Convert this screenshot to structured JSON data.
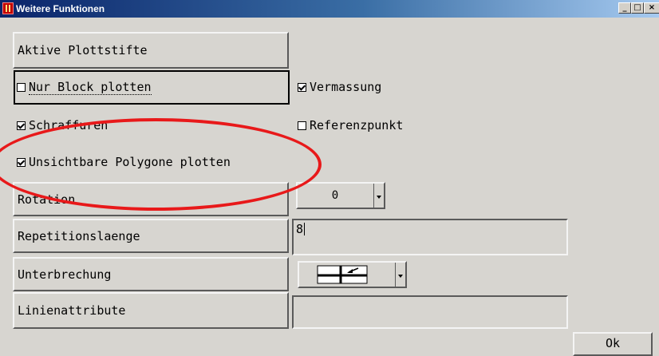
{
  "window": {
    "title": "Weitere Funktionen",
    "min": "_",
    "max": "□",
    "close": "×"
  },
  "buttons": {
    "aktive_plottstifte": "Aktive Plottstifte",
    "rotation": "Rotation",
    "repetitionslaenge": "Repetitionslaenge",
    "unterbrechung": "Unterbrechung",
    "linienattribute": "Linienattribute",
    "ok": "Ok"
  },
  "checkboxes": {
    "nur_block_plotten": {
      "label": "Nur Block plotten",
      "checked": false
    },
    "vermassung": {
      "label": "Vermassung",
      "checked": true
    },
    "schraffuren": {
      "label": "Schraffuren",
      "checked": true
    },
    "referenzpunkt": {
      "label": "Referenzpunkt",
      "checked": false
    },
    "unsichtbare_polygone": {
      "label": "Unsichtbare Polygone plotten",
      "checked": true
    }
  },
  "rotation": {
    "value": "0"
  },
  "repetitionslaenge": {
    "value": "8"
  },
  "linienattribute": {
    "value": ""
  },
  "colors": {
    "highlight": "#e8191a",
    "titlebar": "#0a246a",
    "background": "#d7d5d0"
  },
  "icons": {
    "app": "app-icon",
    "linestyle": "line-break-icon"
  }
}
